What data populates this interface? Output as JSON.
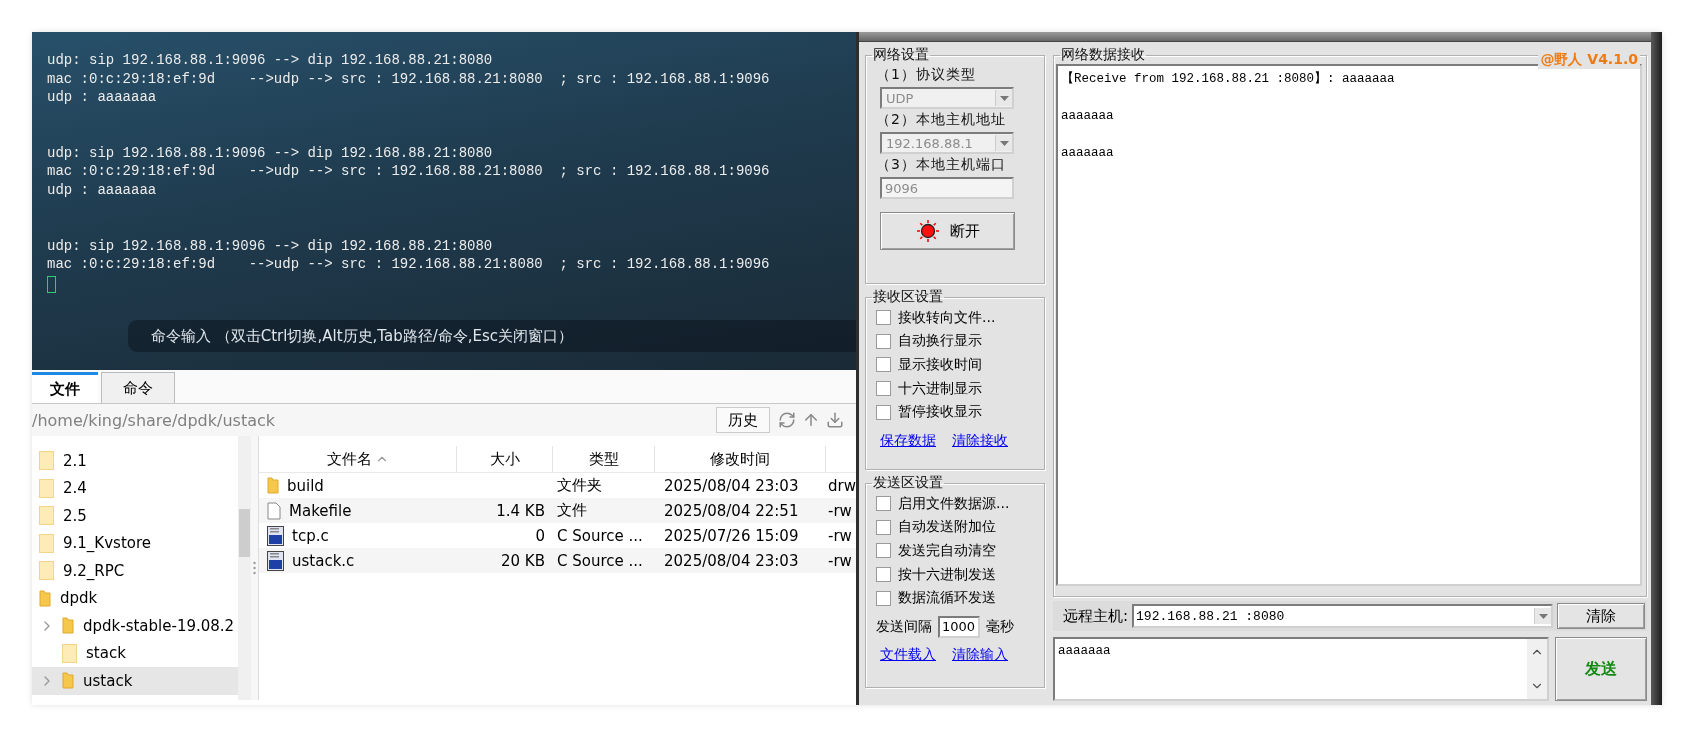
{
  "terminal": {
    "blocks": [
      {
        "lines": [
          "udp: sip 192.168.88.1:9096 --> dip 192.168.88.21:8080",
          "mac :0:c:29:18:ef:9d    -->udp --> src : 192.168.88.21:8080  ; src : 192.168.88.1:9096",
          "udp : aaaaaaa"
        ]
      },
      {
        "lines": [
          "udp: sip 192.168.88.1:9096 --> dip 192.168.88.21:8080",
          "mac :0:c:29:18:ef:9d    -->udp --> src : 192.168.88.21:8080  ; src : 192.168.88.1:9096",
          "udp : aaaaaaa"
        ]
      },
      {
        "lines": [
          "udp: sip 192.168.88.1:9096 --> dip 192.168.88.21:8080",
          "mac :0:c:29:18:ef:9d    -->udp --> src : 192.168.88.21:8080  ; src : 192.168.88.1:9096"
        ]
      }
    ],
    "command_hint": "命令输入 （双击Ctrl切换,Alt历史,Tab路径/命令,Esc关闭窗口）"
  },
  "file_manager": {
    "tabs": [
      {
        "label": "文件",
        "selected": true
      },
      {
        "label": "命令",
        "selected": false
      }
    ],
    "path": "/home/king/share/dpdk/ustack",
    "history_button": "历史",
    "tree": [
      {
        "label": "2.1",
        "kind": "leaf",
        "selected": false
      },
      {
        "label": "2.4",
        "kind": "leaf",
        "selected": false
      },
      {
        "label": "2.5",
        "kind": "leaf",
        "selected": false
      },
      {
        "label": "9.1_Kvstore",
        "kind": "leaf",
        "selected": false
      },
      {
        "label": "9.2_RPC",
        "kind": "leaf",
        "selected": false
      },
      {
        "label": "dpdk",
        "kind": "branch",
        "expanded": true,
        "selected": false,
        "children": [
          {
            "label": "dpdk-stable-19.08.2",
            "kind": "branch",
            "expanded": false,
            "selected": false
          },
          {
            "label": "stack",
            "kind": "leaf",
            "selected": false
          },
          {
            "label": "ustack",
            "kind": "branch",
            "expanded": false,
            "selected": true
          }
        ]
      }
    ],
    "columns": [
      {
        "label": "文件名",
        "sorted": true
      },
      {
        "label": "大小",
        "sorted": false
      },
      {
        "label": "类型",
        "sorted": false
      },
      {
        "label": "修改时间",
        "sorted": false
      }
    ],
    "rows": [
      {
        "kind": "folder",
        "name": "build",
        "size": "",
        "type": "文件夹",
        "modified": "2025/08/04 23:03",
        "column_5": "drw"
      },
      {
        "kind": "file",
        "name": "Makefile",
        "size": "1.4 KB",
        "type": "文件",
        "modified": "2025/08/04 22:51",
        "column_5": "-rw"
      },
      {
        "kind": "c_source",
        "name": "tcp.c",
        "size": "0",
        "type": "C Source ...",
        "modified": "2025/07/26 15:09",
        "column_5": "-rw"
      },
      {
        "kind": "c_source",
        "name": "ustack.c",
        "size": "20 KB",
        "type": "C Source ...",
        "modified": "2025/08/04 23:03",
        "column_5": "-rw"
      }
    ]
  },
  "network_settings": {
    "title": "网络设置",
    "protocol_label": "（1）协议类型",
    "protocol": "UDP",
    "host_label": "（2）本地主机地址",
    "host": "192.168.88.1",
    "port_label": "（3）本地主机端口",
    "port": "9096",
    "disabled": true,
    "connected": true,
    "connect_button": "断开"
  },
  "receive_settings": {
    "title": "接收区设置",
    "options": [
      {
        "label": "接收转向文件...",
        "checked": false
      },
      {
        "label": "自动换行显示",
        "checked": false
      },
      {
        "label": "显示接收时间",
        "checked": false
      },
      {
        "label": "十六进制显示",
        "checked": false
      },
      {
        "label": "暂停接收显示",
        "checked": false
      }
    ],
    "links": [
      "保存数据",
      "清除接收"
    ]
  },
  "send_settings": {
    "title": "发送区设置",
    "options": [
      {
        "label": "启用文件数据源...",
        "checked": false
      },
      {
        "label": "自动发送附加位",
        "checked": false
      },
      {
        "label": "发送完自动清空",
        "checked": false
      },
      {
        "label": "按十六进制发送",
        "checked": false
      },
      {
        "label": "数据流循环发送",
        "checked": false
      }
    ],
    "interval_label": "发送间隔",
    "interval": "1000",
    "interval_unit": "毫秒",
    "links": [
      "文件载入",
      "清除输入"
    ]
  },
  "receive": {
    "title": "网络数据接收",
    "badge": "@野人 V4.1.0",
    "lines": [
      "【Receive from 192.168.88.21 :8080】: aaaaaaa",
      "aaaaaaa",
      "aaaaaaa"
    ]
  },
  "remote": {
    "label": "远程主机:",
    "value": "192.168.88.21 :8080",
    "clear_button": "清除"
  },
  "send": {
    "text": "aaaaaaa",
    "button": "发送"
  }
}
